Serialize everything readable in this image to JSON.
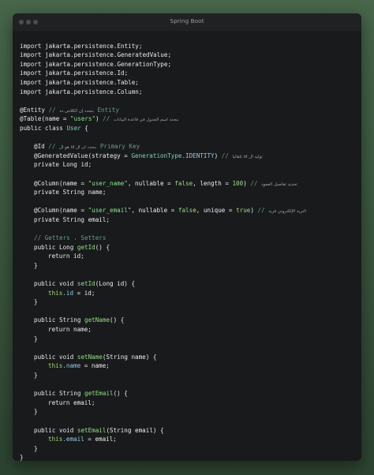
{
  "window": {
    "title": "Spring Boot"
  },
  "code": {
    "imports": [
      "import jakarta.persistence.Entity;",
      "import jakarta.persistence.GeneratedValue;",
      "import jakarta.persistence.GenerationType;",
      "import jakarta.persistence.Id;",
      "import jakarta.persistence.Table;",
      "import jakarta.persistence.Column;"
    ],
    "entity_annotation": "@Entity",
    "entity_comment_prefix": " // ",
    "entity_comment_ar": "بنحدد إن الكلاس ده",
    "entity_comment_en": " Entity",
    "table_annotation": "@Table",
    "table_args_open": "(name = ",
    "table_name": "\"users\"",
    "table_args_close": ")",
    "table_comment_prefix": " // ",
    "table_comment_ar": "بنحدد اسم الجدول في قاعدة البيانات",
    "class_decl_kw": "public class ",
    "class_name": "User",
    "class_open": " {",
    "id_annotation": "@Id",
    "id_comment_prefix": " // ",
    "id_comment_ar": "هو ال id بنحدد ان ال",
    "id_comment_en": " Primary Key",
    "gen_annotation": "@GeneratedValue",
    "gen_args_open": "(strategy = ",
    "gen_type": "GenerationType",
    "gen_value": ".IDENTITY",
    "gen_args_close": ")",
    "gen_comment_prefix": " // ",
    "gen_comment_ar": "تلقائيا id توليد ال",
    "id_field_kw": "private Long ",
    "id_field_name": "id;",
    "col1_annotation": "@Column",
    "col1_args_open": "(name = ",
    "col1_name": "\"user_name\"",
    "col1_nullable_label": ", nullable = ",
    "col1_nullable_value": "false",
    "col1_length_label": ", length = ",
    "col1_length_value": "100",
    "col1_args_close": ")",
    "col1_comment_prefix": " // ",
    "col1_comment_ar": "تحديد تفاصيل العمود",
    "name_field_kw": "private String ",
    "name_field_name": "name;",
    "col2_annotation": "@Column",
    "col2_args_open": "(name = ",
    "col2_name": "\"user_email\"",
    "col2_nullable_label": ", nullable = ",
    "col2_nullable_value": "false",
    "col2_unique_label": ", unique = ",
    "col2_unique_value": "true",
    "col2_args_close": ")",
    "col2_comment_prefix": " // ",
    "col2_comment_ar": "البريد الإلكتروني فريد",
    "email_field_kw": "private String ",
    "email_field_name": "email;",
    "getters_comment": "// Getters ، Setters",
    "get_id_kw": "public Long ",
    "get_id_name": "getId",
    "get_id_tail": "() {",
    "get_id_body": "return id;",
    "set_id_kw": "public void ",
    "set_id_name": "setId",
    "set_id_tail": "(Long id) {",
    "set_id_this": "this",
    "set_id_field": ".id",
    "set_id_rest": " = id;",
    "get_name_kw": "public String ",
    "get_name_name": "getName",
    "get_name_tail": "() {",
    "get_name_body": "return name;",
    "set_name_kw": "public void ",
    "set_name_name": "setName",
    "set_name_tail": "(String name) {",
    "set_name_this": "this",
    "set_name_field": ".name",
    "set_name_rest": " = name;",
    "get_email_kw": "public String ",
    "get_email_name": "getEmail",
    "get_email_tail": "() {",
    "get_email_body": "return email;",
    "set_email_kw": "public void ",
    "set_email_name": "setEmail",
    "set_email_tail": "(String email) {",
    "set_email_this": "this",
    "set_email_field": ".email",
    "set_email_rest": " = email;",
    "close_brace": "}"
  }
}
